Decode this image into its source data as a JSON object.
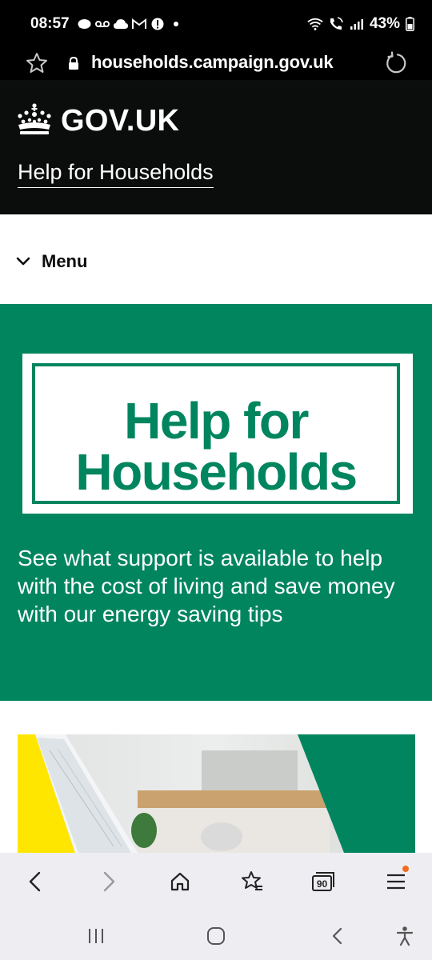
{
  "status_bar": {
    "time": "08:57",
    "battery": "43%",
    "left_icons": [
      "whatsapp-icon",
      "voicemail-icon",
      "cloud-icon",
      "gmail-icon",
      "alert-icon",
      "dot-icon"
    ],
    "right_icons": [
      "wifi-icon",
      "wifi-call-icon",
      "signal-icon",
      "battery-icon"
    ]
  },
  "url_bar": {
    "url": "households.campaign.gov.uk"
  },
  "gov_header": {
    "logo_text": "GOV.UK",
    "service_name": "Help for Households"
  },
  "menu": {
    "label": "Menu"
  },
  "hero": {
    "logo_line1": "Help for",
    "logo_line2": "Households",
    "description": "See what support is available to help with the cost of living and save money with our energy saving tips"
  },
  "browser_toolbar": {
    "tab_count": "90"
  },
  "colors": {
    "header_bg": "#0b0c0c",
    "brand_green": "#00855f",
    "accent_yellow": "#ffe600",
    "notification_dot": "#f36c21",
    "toolbar_bg": "#eeeef2"
  }
}
